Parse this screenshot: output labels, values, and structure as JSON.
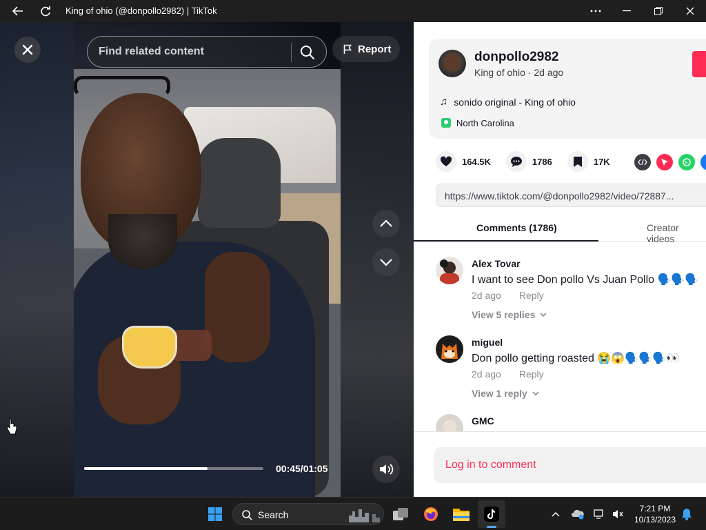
{
  "window": {
    "title": "King of ohio (@donpollo2982) | TikTok"
  },
  "video": {
    "search_placeholder": "Find related content",
    "report_label": "Report",
    "time": "00:45/01:05",
    "progress": 0.69
  },
  "author": {
    "username": "donpollo2982",
    "subtitle": "King of ohio · 2d ago",
    "music": "sonido original - King of ohio",
    "location": "North Carolina"
  },
  "stats": {
    "likes": "164.5K",
    "comments": "1786",
    "saves": "17K"
  },
  "share_link": "https://www.tiktok.com/@donpollo2982/video/72887...",
  "tabs": [
    {
      "label": "Comments (1786)",
      "active": true
    },
    {
      "label": "Creator videos",
      "active": false
    }
  ],
  "comments": [
    {
      "name": "Alex Tovar",
      "text": "I want to see Don pollo Vs Juan Pollo 🗣️🗣️🗣️",
      "time": "2d ago",
      "reply": "Reply",
      "replies": "View 5 replies"
    },
    {
      "name": "miguel",
      "text": "Don pollo getting roasted 😭😱🗣️🗣️🗣️👀",
      "time": "2d ago",
      "reply": "Reply",
      "replies": "View 1 reply"
    },
    {
      "name": "GMC",
      "text": "",
      "time": "",
      "reply": "",
      "replies": ""
    }
  ],
  "footer": {
    "login_label": "Log in to comment"
  },
  "taskbar": {
    "search_label": "Search",
    "time": "7:21 PM",
    "date": "10/13/2023"
  },
  "colors": {
    "accent": "#fe2c55",
    "location_badge": "#2ecc71"
  }
}
